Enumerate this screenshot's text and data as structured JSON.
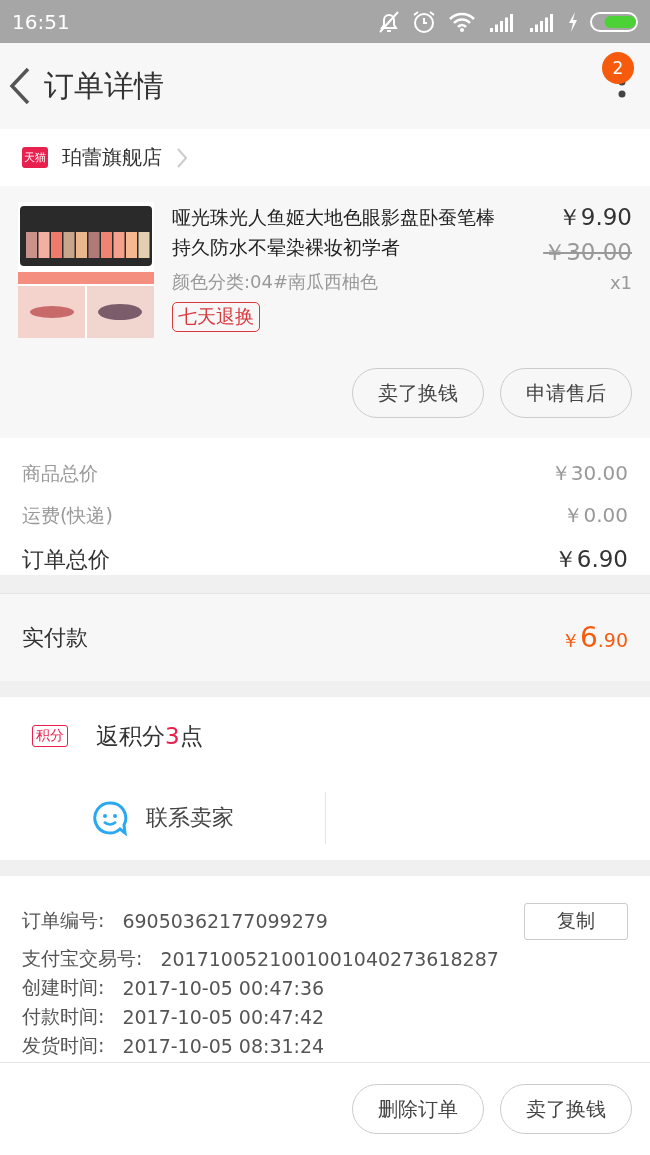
{
  "status_bar": {
    "time": "16:51",
    "battery": {
      "level": 0.75
    }
  },
  "header": {
    "title": "订单详情",
    "badge": "2"
  },
  "store": {
    "tag": "天猫",
    "name": "珀蕾旗舰店"
  },
  "product": {
    "picture": {
      "kind": "picture"
    },
    "title": "哑光珠光人鱼姬大地色眼影盘卧蚕笔棒持久防水不晕染裸妆初学者",
    "variant": "颜色分类:04#南瓜西柚色",
    "badge": "七天退换",
    "price": "￥9.90",
    "original_price": "￥30.00",
    "quantity": "x1",
    "buttons": [
      "卖了换钱",
      "申请售后"
    ]
  },
  "totals": [
    {
      "label": "商品总价",
      "value": "￥30.00",
      "kind": "minor"
    },
    {
      "label": "运费(快递)",
      "value": "￥0.00",
      "kind": "minor"
    },
    {
      "label": "订单总价",
      "value": "￥6.90",
      "kind": "major"
    }
  ],
  "paid": {
    "label": "实付款",
    "currency": "￥",
    "integer": "6",
    "decimal": ".90"
  },
  "points": {
    "tag": "积分",
    "prefix": "返积分",
    "amount": "3",
    "suffix": "点"
  },
  "contact": {
    "label": "联系卖家"
  },
  "details": {
    "copy_button": "复制",
    "rows": [
      {
        "label": "订单编号:",
        "value": "69050362177099279"
      },
      {
        "label": "支付宝交易号:",
        "value": "2017100521001001040273618287"
      },
      {
        "label": "创建时间:",
        "value": "2017-10-05 00:47:36"
      },
      {
        "label": "付款时间:",
        "value": "2017-10-05 00:47:42"
      },
      {
        "label": "发货时间:",
        "value": "2017-10-05 08:31:24"
      }
    ]
  },
  "bottom_buttons": [
    "删除订单",
    "卖了换钱"
  ]
}
